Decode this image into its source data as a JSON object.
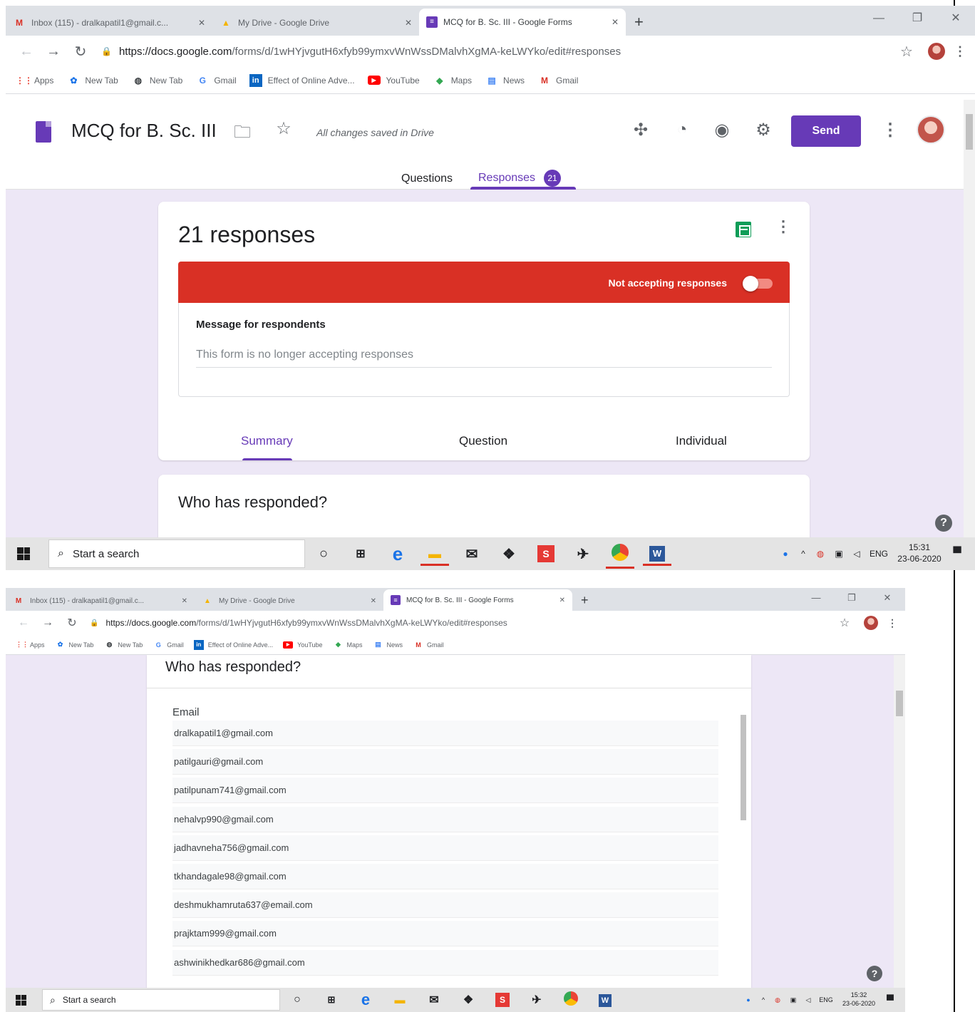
{
  "browser": {
    "tabs": [
      {
        "title": "Inbox (115) - dralkapatil1@gmail.c...",
        "icon": "gmail-icon"
      },
      {
        "title": "My Drive - Google Drive",
        "icon": "drive-icon"
      },
      {
        "title": "MCQ for B. Sc. III - Google Forms",
        "icon": "forms-icon",
        "active": true
      }
    ],
    "new_tab": "+",
    "url_host": "https://docs.google.com",
    "url_path": "/forms/d/1wHYjvgutH6xfyb99ymxvWnWssDMalvhXgMA-keLWYko/edit#responses",
    "bookmarks": [
      {
        "label": "Apps",
        "icon": "apps-icon"
      },
      {
        "label": "New Tab",
        "icon": "new-tab-icon"
      },
      {
        "label": "New Tab",
        "icon": "globe-icon"
      },
      {
        "label": "Gmail",
        "icon": "google-icon"
      },
      {
        "label": "Effect of Online Adve...",
        "icon": "linkedin-icon"
      },
      {
        "label": "YouTube",
        "icon": "youtube-icon"
      },
      {
        "label": "Maps",
        "icon": "maps-icon"
      },
      {
        "label": "News",
        "icon": "news-icon"
      },
      {
        "label": "Gmail",
        "icon": "gmail-icon"
      }
    ]
  },
  "form": {
    "title": "MCQ for B. Sc. III",
    "save_status": "All changes saved in Drive",
    "send_label": "Send",
    "tabs": {
      "questions": "Questions",
      "responses": "Responses",
      "responses_count": "21"
    },
    "responses_title": "21 responses",
    "accepting_label": "Not accepting responses",
    "message_heading": "Message for respondents",
    "message_text": "This form is no longer accepting responses",
    "subtabs": {
      "summary": "Summary",
      "question": "Question",
      "individual": "Individual"
    },
    "who_heading": "Who has responded?",
    "email_header": "Email",
    "emails": [
      "dralkapatil1@gmail.com",
      "patilgauri@gmail.com",
      "patilpunam741@gmail.com",
      "nehalvp990@gmail.com",
      "jadhavneha756@gmail.com",
      "tkhandagale98@gmail.com",
      "deshmukhamruta637@email.com",
      "prajktam999@gmail.com",
      "ashwinikhedkar686@gmail.com"
    ]
  },
  "taskbar": {
    "search_placeholder": "Start a search",
    "lang": "ENG",
    "time1": "15:31",
    "date1": "23-06-2020",
    "time2": "15:32",
    "date2": "23-06-2020"
  },
  "colors": {
    "accent": "#673ab7",
    "danger": "#d93025",
    "background": "#ede7f6",
    "sheets": "#0f9d58"
  }
}
